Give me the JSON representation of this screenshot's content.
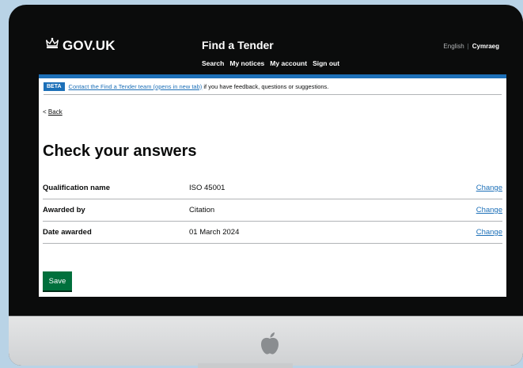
{
  "header": {
    "logo_text": "GOV.UK",
    "service_name": "Find a Tender",
    "nav": [
      "Search",
      "My notices",
      "My account",
      "Sign out"
    ],
    "language": {
      "english": "English",
      "separator": "|",
      "welsh": "Cymraeg"
    }
  },
  "phase_banner": {
    "tag": "BETA",
    "link_text": "Contact the Find a Tender team (opens in new tab)",
    "text": "if you have feedback, questions or suggestions."
  },
  "back_link": {
    "chevron": "<",
    "label": "Back"
  },
  "page_title": "Check your answers",
  "summary": [
    {
      "key": "Qualification name",
      "value": "ISO 45001",
      "action": "Change"
    },
    {
      "key": "Awarded by",
      "value": "Citation",
      "action": "Change"
    },
    {
      "key": "Date awarded",
      "value": "01 March 2024",
      "action": "Change"
    }
  ],
  "save_button": "Save",
  "colors": {
    "header_bg": "#0b0c0c",
    "brand_blue": "#1d70b8",
    "button_green": "#00703c",
    "page_bg": "#b9d3e6"
  },
  "icons": {
    "logo": "crown-icon",
    "device_logo": "apple-icon"
  }
}
